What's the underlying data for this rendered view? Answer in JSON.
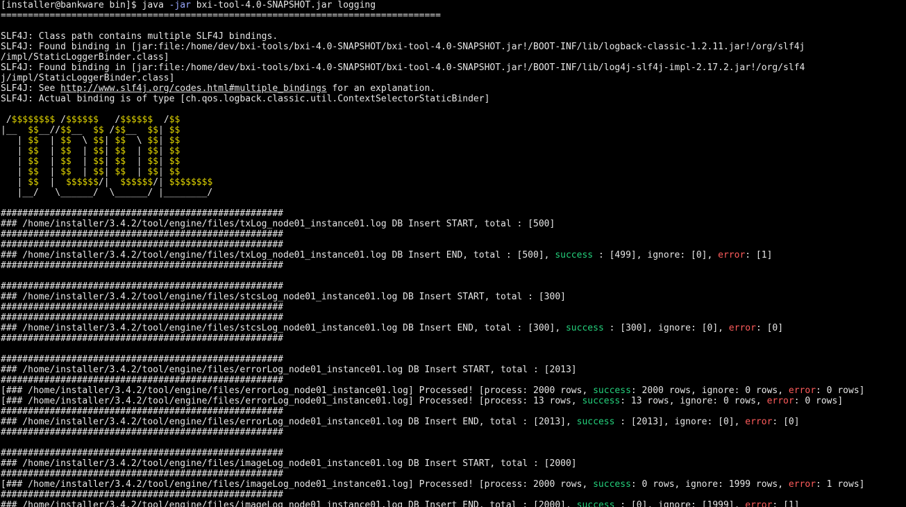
{
  "colors": {
    "background": "#000000",
    "text": "#e6e6e6",
    "success": "#24d17c",
    "error": "#ff5c5c",
    "ascii_art": "#e0d400",
    "option": "#9aa8ff"
  },
  "lines": [
    {
      "segments": [
        {
          "t": "[installer@bankware bin]$ java "
        },
        {
          "t": "-jar",
          "c": "opt"
        },
        {
          "t": " bxi-tool-4.0-SNAPSHOT.jar logging"
        }
      ]
    },
    {
      "segments": [
        {
          "t": "================================================================================="
        }
      ]
    },
    {
      "segments": [
        {
          "t": ""
        }
      ]
    },
    {
      "segments": [
        {
          "t": "SLF4J: Class path contains multiple SLF4J bindings."
        }
      ]
    },
    {
      "segments": [
        {
          "t": "SLF4J: Found binding in [jar:file:/home/dev/bxi-tools/bxi-4.0-SNAPSHOT/bxi-tool-4.0-SNAPSHOT.jar!/BOOT-INF/lib/logback-classic-1.2.11.jar!/org/slf4j"
        }
      ]
    },
    {
      "segments": [
        {
          "t": "/impl/StaticLoggerBinder.class]"
        }
      ]
    },
    {
      "segments": [
        {
          "t": "SLF4J: Found binding in [jar:file:/home/dev/bxi-tools/bxi-4.0-SNAPSHOT/bxi-tool-4.0-SNAPSHOT.jar!/BOOT-INF/lib/log4j-slf4j-impl-2.17.2.jar!/org/slf4"
        }
      ]
    },
    {
      "segments": [
        {
          "t": "j/impl/StaticLoggerBinder.class]"
        }
      ]
    },
    {
      "segments": [
        {
          "t": "SLF4J: See "
        },
        {
          "t": "http://www.slf4j.org/codes.html#multiple_bindings",
          "c": "link"
        },
        {
          "t": " for an explanation."
        }
      ]
    },
    {
      "segments": [
        {
          "t": "SLF4J: Actual binding is of type [ch.qos.logback.classic.util.ContextSelectorStaticBinder]"
        }
      ]
    },
    {
      "segments": [
        {
          "t": ""
        }
      ]
    },
    {
      "segments": [
        {
          "t": " /"
        },
        {
          "t": "$$$$$$$$",
          "c": "yel"
        },
        {
          "t": " /"
        },
        {
          "t": "$$$$$$",
          "c": "yel"
        },
        {
          "t": "   /"
        },
        {
          "t": "$$$$$$",
          "c": "yel"
        },
        {
          "t": "  /"
        },
        {
          "t": "$$",
          "c": "yel"
        }
      ]
    },
    {
      "segments": [
        {
          "t": "|__  "
        },
        {
          "t": "$$",
          "c": "yel"
        },
        {
          "t": "__//"
        },
        {
          "t": "$$",
          "c": "yel"
        },
        {
          "t": "__  "
        },
        {
          "t": "$$",
          "c": "yel"
        },
        {
          "t": " /"
        },
        {
          "t": "$$",
          "c": "yel"
        },
        {
          "t": "__  "
        },
        {
          "t": "$$",
          "c": "yel"
        },
        {
          "t": "| "
        },
        {
          "t": "$$",
          "c": "yel"
        }
      ]
    },
    {
      "segments": [
        {
          "t": "   | "
        },
        {
          "t": "$$",
          "c": "yel"
        },
        {
          "t": "  | "
        },
        {
          "t": "$$",
          "c": "yel"
        },
        {
          "t": "  \\ "
        },
        {
          "t": "$$",
          "c": "yel"
        },
        {
          "t": "| "
        },
        {
          "t": "$$",
          "c": "yel"
        },
        {
          "t": "  \\ "
        },
        {
          "t": "$$",
          "c": "yel"
        },
        {
          "t": "| "
        },
        {
          "t": "$$",
          "c": "yel"
        }
      ]
    },
    {
      "segments": [
        {
          "t": "   | "
        },
        {
          "t": "$$",
          "c": "yel"
        },
        {
          "t": "  | "
        },
        {
          "t": "$$",
          "c": "yel"
        },
        {
          "t": "  | "
        },
        {
          "t": "$$",
          "c": "yel"
        },
        {
          "t": "| "
        },
        {
          "t": "$$",
          "c": "yel"
        },
        {
          "t": "  | "
        },
        {
          "t": "$$",
          "c": "yel"
        },
        {
          "t": "| "
        },
        {
          "t": "$$",
          "c": "yel"
        }
      ]
    },
    {
      "segments": [
        {
          "t": "   | "
        },
        {
          "t": "$$",
          "c": "yel"
        },
        {
          "t": "  | "
        },
        {
          "t": "$$",
          "c": "yel"
        },
        {
          "t": "  | "
        },
        {
          "t": "$$",
          "c": "yel"
        },
        {
          "t": "| "
        },
        {
          "t": "$$",
          "c": "yel"
        },
        {
          "t": "  | "
        },
        {
          "t": "$$",
          "c": "yel"
        },
        {
          "t": "| "
        },
        {
          "t": "$$",
          "c": "yel"
        }
      ]
    },
    {
      "segments": [
        {
          "t": "   | "
        },
        {
          "t": "$$",
          "c": "yel"
        },
        {
          "t": "  | "
        },
        {
          "t": "$$",
          "c": "yel"
        },
        {
          "t": "  | "
        },
        {
          "t": "$$",
          "c": "yel"
        },
        {
          "t": "| "
        },
        {
          "t": "$$",
          "c": "yel"
        },
        {
          "t": "  | "
        },
        {
          "t": "$$",
          "c": "yel"
        },
        {
          "t": "| "
        },
        {
          "t": "$$",
          "c": "yel"
        }
      ]
    },
    {
      "segments": [
        {
          "t": "   | "
        },
        {
          "t": "$$",
          "c": "yel"
        },
        {
          "t": "  |  "
        },
        {
          "t": "$$$$$$",
          "c": "yel"
        },
        {
          "t": "/|  "
        },
        {
          "t": "$$$$$$",
          "c": "yel"
        },
        {
          "t": "/| "
        },
        {
          "t": "$$$$$$$$",
          "c": "yel"
        }
      ]
    },
    {
      "segments": [
        {
          "t": "   |__/   \\______/  \\______/ |________/"
        }
      ]
    },
    {
      "segments": [
        {
          "t": ""
        }
      ]
    },
    {
      "segments": [
        {
          "t": "####################################################"
        }
      ]
    },
    {
      "segments": [
        {
          "t": "### /home/installer/3.4.2/tool/engine/files/txLog_node01_instance01.log DB Insert START, total : [500]"
        }
      ]
    },
    {
      "segments": [
        {
          "t": "####################################################"
        }
      ]
    },
    {
      "segments": [
        {
          "t": "####################################################"
        }
      ]
    },
    {
      "segments": [
        {
          "t": "### /home/installer/3.4.2/tool/engine/files/txLog_node01_instance01.log DB Insert END, total : [500], "
        },
        {
          "t": "success",
          "c": "ok"
        },
        {
          "t": " : [499], ignore: [0], "
        },
        {
          "t": "error",
          "c": "err"
        },
        {
          "t": ": [1]"
        }
      ]
    },
    {
      "segments": [
        {
          "t": "####################################################"
        }
      ]
    },
    {
      "segments": [
        {
          "t": ""
        }
      ]
    },
    {
      "segments": [
        {
          "t": "####################################################"
        }
      ]
    },
    {
      "segments": [
        {
          "t": "### /home/installer/3.4.2/tool/engine/files/stcsLog_node01_instance01.log DB Insert START, total : [300]"
        }
      ]
    },
    {
      "segments": [
        {
          "t": "####################################################"
        }
      ]
    },
    {
      "segments": [
        {
          "t": "####################################################"
        }
      ]
    },
    {
      "segments": [
        {
          "t": "### /home/installer/3.4.2/tool/engine/files/stcsLog_node01_instance01.log DB Insert END, total : [300], "
        },
        {
          "t": "success",
          "c": "ok"
        },
        {
          "t": " : [300], ignore: [0], "
        },
        {
          "t": "error",
          "c": "err"
        },
        {
          "t": ": [0]"
        }
      ]
    },
    {
      "segments": [
        {
          "t": "####################################################"
        }
      ]
    },
    {
      "segments": [
        {
          "t": ""
        }
      ]
    },
    {
      "segments": [
        {
          "t": "####################################################"
        }
      ]
    },
    {
      "segments": [
        {
          "t": "### /home/installer/3.4.2/tool/engine/files/errorLog_node01_instance01.log DB Insert START, total : [2013]"
        }
      ]
    },
    {
      "segments": [
        {
          "t": "####################################################"
        }
      ]
    },
    {
      "segments": [
        {
          "t": "[### /home/installer/3.4.2/tool/engine/files/errorLog_node01_instance01.log] Processed! [process: 2000 rows, "
        },
        {
          "t": "success",
          "c": "ok"
        },
        {
          "t": ": 2000 rows, ignore: 0 rows, "
        },
        {
          "t": "error",
          "c": "err"
        },
        {
          "t": ": 0 rows]"
        }
      ]
    },
    {
      "segments": [
        {
          "t": "[### /home/installer/3.4.2/tool/engine/files/errorLog_node01_instance01.log] Processed! [process: 13 rows, "
        },
        {
          "t": "success",
          "c": "ok"
        },
        {
          "t": ": 13 rows, ignore: 0 rows, "
        },
        {
          "t": "error",
          "c": "err"
        },
        {
          "t": ": 0 rows]"
        }
      ]
    },
    {
      "segments": [
        {
          "t": "####################################################"
        }
      ]
    },
    {
      "segments": [
        {
          "t": "### /home/installer/3.4.2/tool/engine/files/errorLog_node01_instance01.log DB Insert END, total : [2013], "
        },
        {
          "t": "success",
          "c": "ok"
        },
        {
          "t": " : [2013], ignore: [0], "
        },
        {
          "t": "error",
          "c": "err"
        },
        {
          "t": ": [0]"
        }
      ]
    },
    {
      "segments": [
        {
          "t": "####################################################"
        }
      ]
    },
    {
      "segments": [
        {
          "t": ""
        }
      ]
    },
    {
      "segments": [
        {
          "t": "####################################################"
        }
      ]
    },
    {
      "segments": [
        {
          "t": "### /home/installer/3.4.2/tool/engine/files/imageLog_node01_instance01.log DB Insert START, total : [2000]"
        }
      ]
    },
    {
      "segments": [
        {
          "t": "####################################################"
        }
      ]
    },
    {
      "segments": [
        {
          "t": "[### /home/installer/3.4.2/tool/engine/files/imageLog_node01_instance01.log] Processed! [process: 2000 rows, "
        },
        {
          "t": "success",
          "c": "ok"
        },
        {
          "t": ": 0 rows, ignore: 1999 rows, "
        },
        {
          "t": "error",
          "c": "err"
        },
        {
          "t": ": 1 rows]"
        }
      ]
    },
    {
      "segments": [
        {
          "t": "####################################################"
        }
      ]
    },
    {
      "segments": [
        {
          "t": "### /home/installer/3.4.2/tool/engine/files/imageLog_node01_instance01.log DB Insert END, total : [2000], "
        },
        {
          "t": "success",
          "c": "ok"
        },
        {
          "t": " : [0], ignore: [1999], "
        },
        {
          "t": "error",
          "c": "err"
        },
        {
          "t": ": [1]"
        }
      ]
    }
  ]
}
